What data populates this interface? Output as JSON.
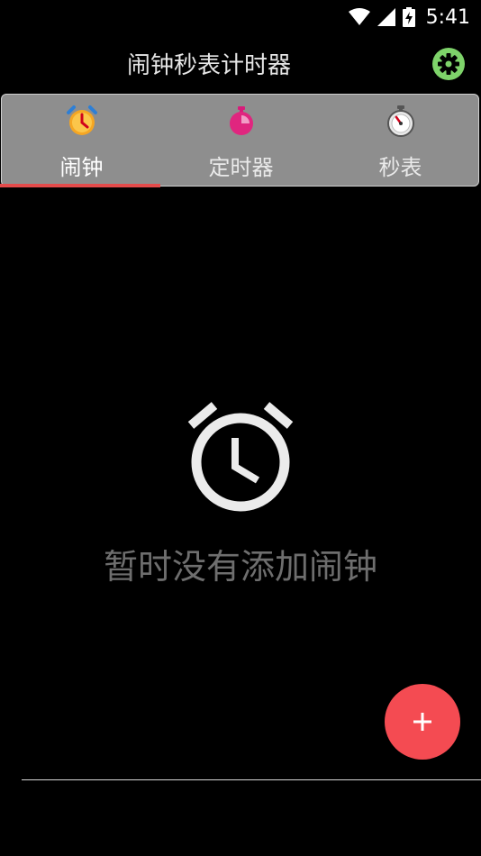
{
  "status_bar": {
    "time": "5:41"
  },
  "app_bar": {
    "title": "闹钟秒表计时器",
    "settings_icon": "gear-icon",
    "accent": "#7ed36a"
  },
  "tabs": [
    {
      "label": "闹钟",
      "icon": "alarm-clock-icon",
      "selected": true,
      "label_color": "#ffffff"
    },
    {
      "label": "定时器",
      "icon": "timer-icon",
      "selected": false,
      "label_color": "#eaeaea"
    },
    {
      "label": "秒表",
      "icon": "stopwatch-icon",
      "selected": false,
      "label_color": "#eaeaea"
    }
  ],
  "tab_indicator_color": "#e34b4b",
  "empty_state": {
    "icon": "alarm-icon",
    "message": "暂时没有添加闹钟"
  },
  "fab": {
    "icon": "plus-icon",
    "color": "#f44b52"
  }
}
